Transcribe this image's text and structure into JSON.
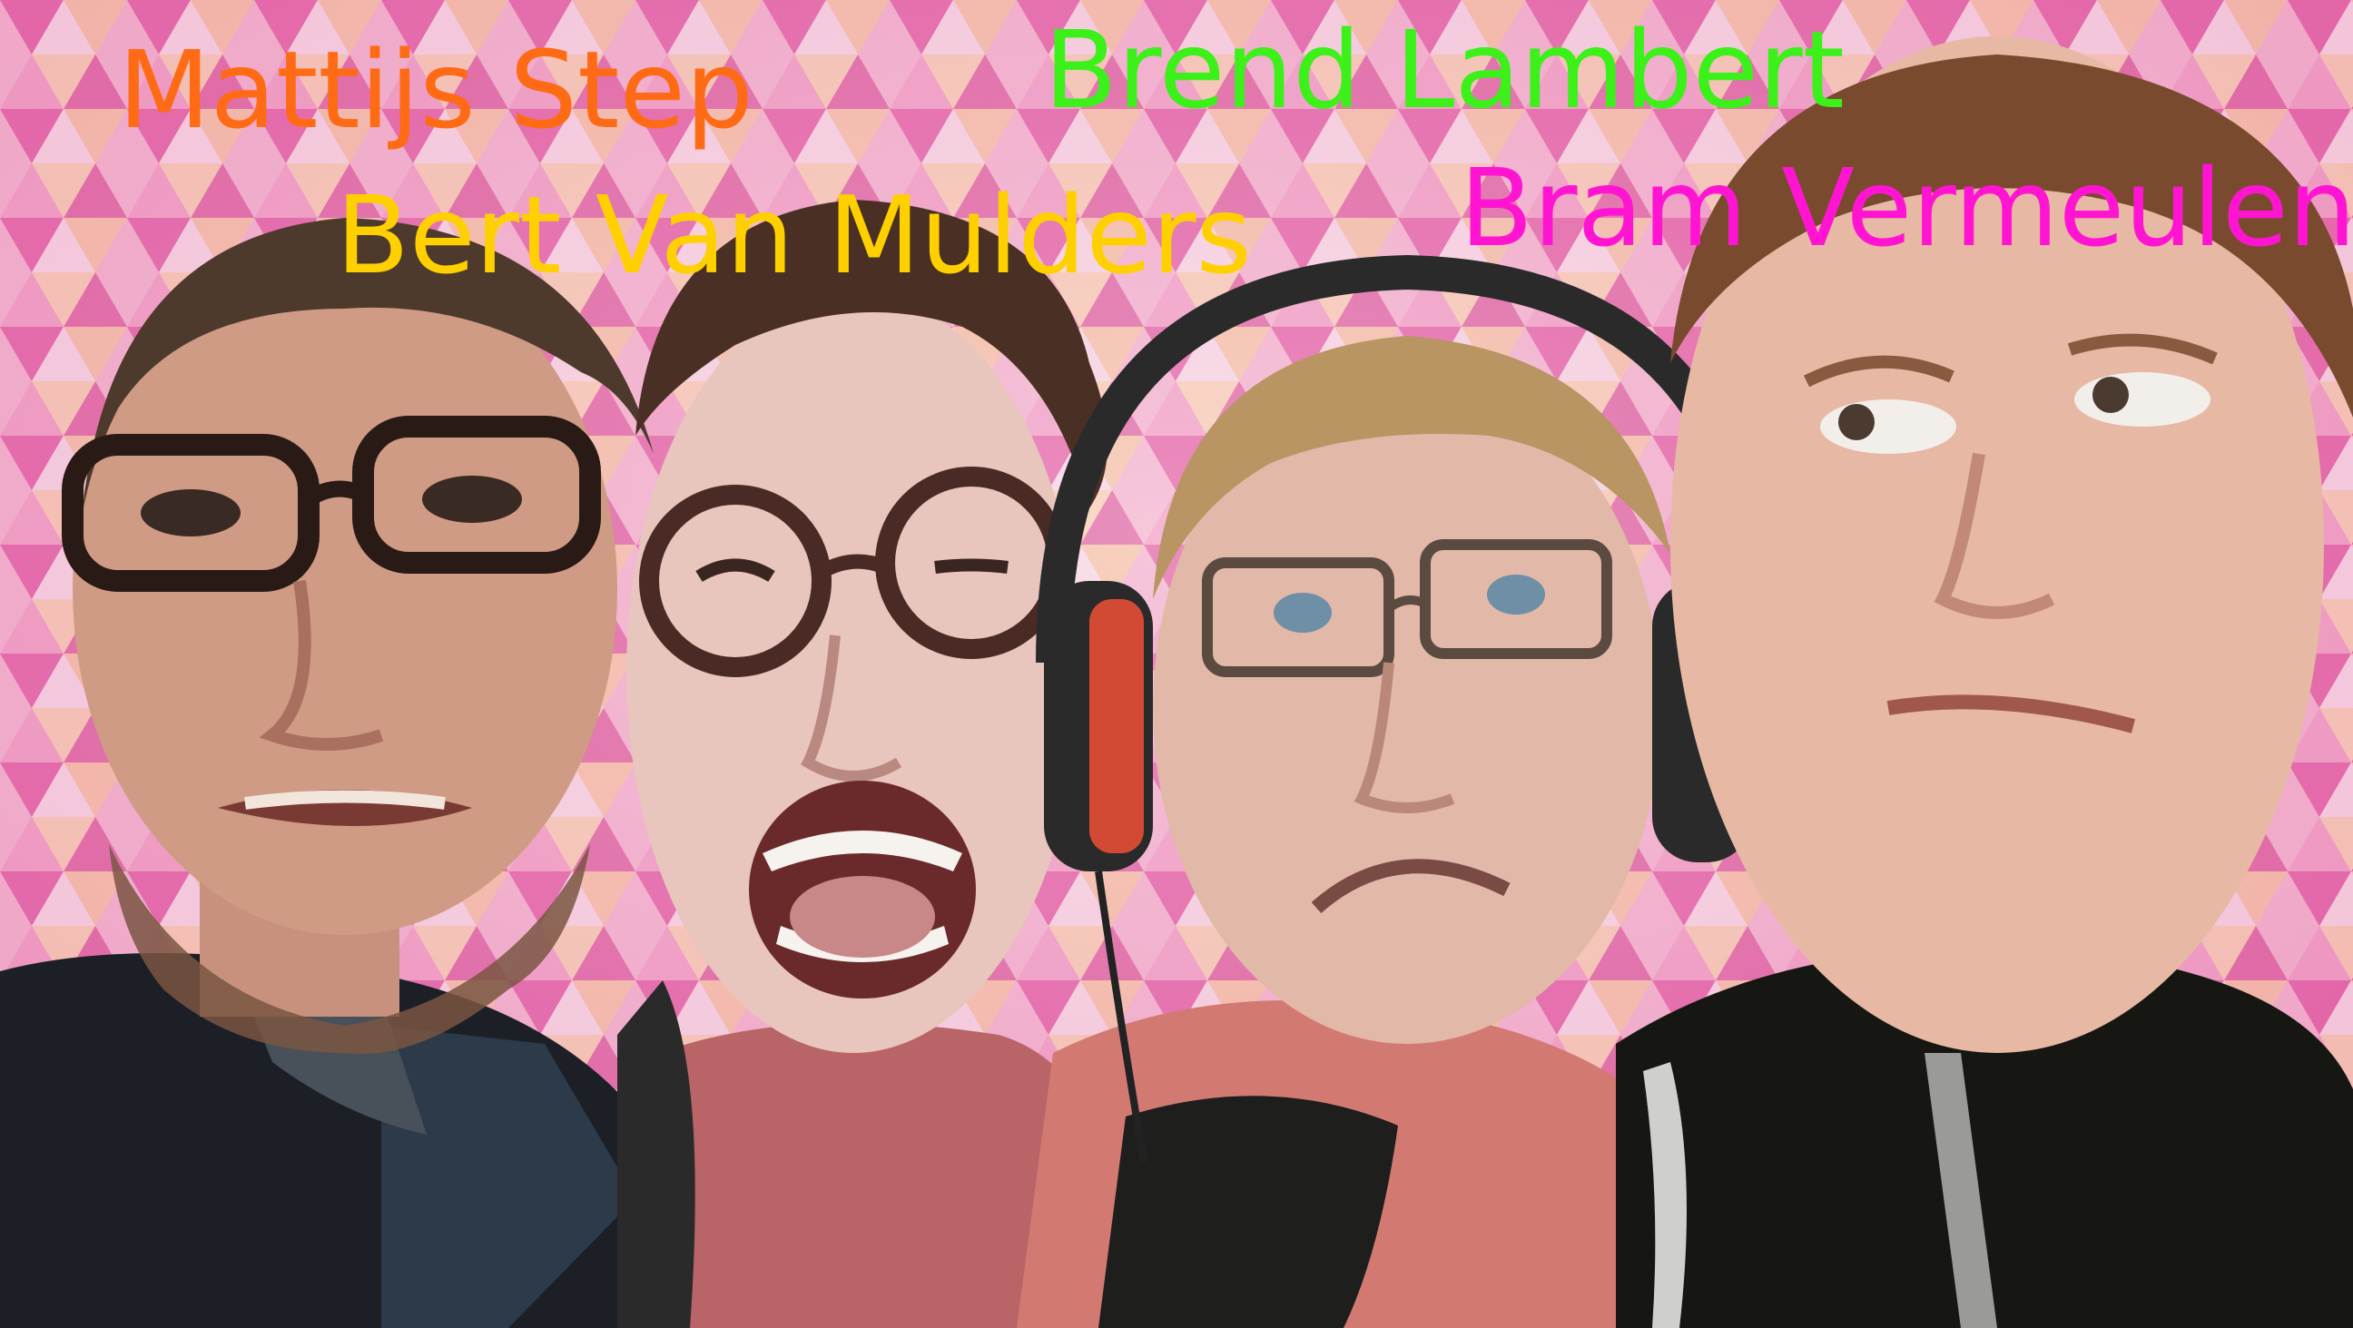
{
  "names": [
    {
      "text": "Mattijs Step",
      "color": "#ff6a14"
    },
    {
      "text": "Brend Lambert",
      "color": "#3cf01a"
    },
    {
      "text": "Bert Van Mulders",
      "color": "#ffd000"
    },
    {
      "text": "Bram Vermeulen",
      "color": "#ff14d2"
    }
  ],
  "palette": {
    "background_pink": "#e0559e",
    "background_peach": "#f6c7a7",
    "background_light": "#f8dfe9"
  }
}
